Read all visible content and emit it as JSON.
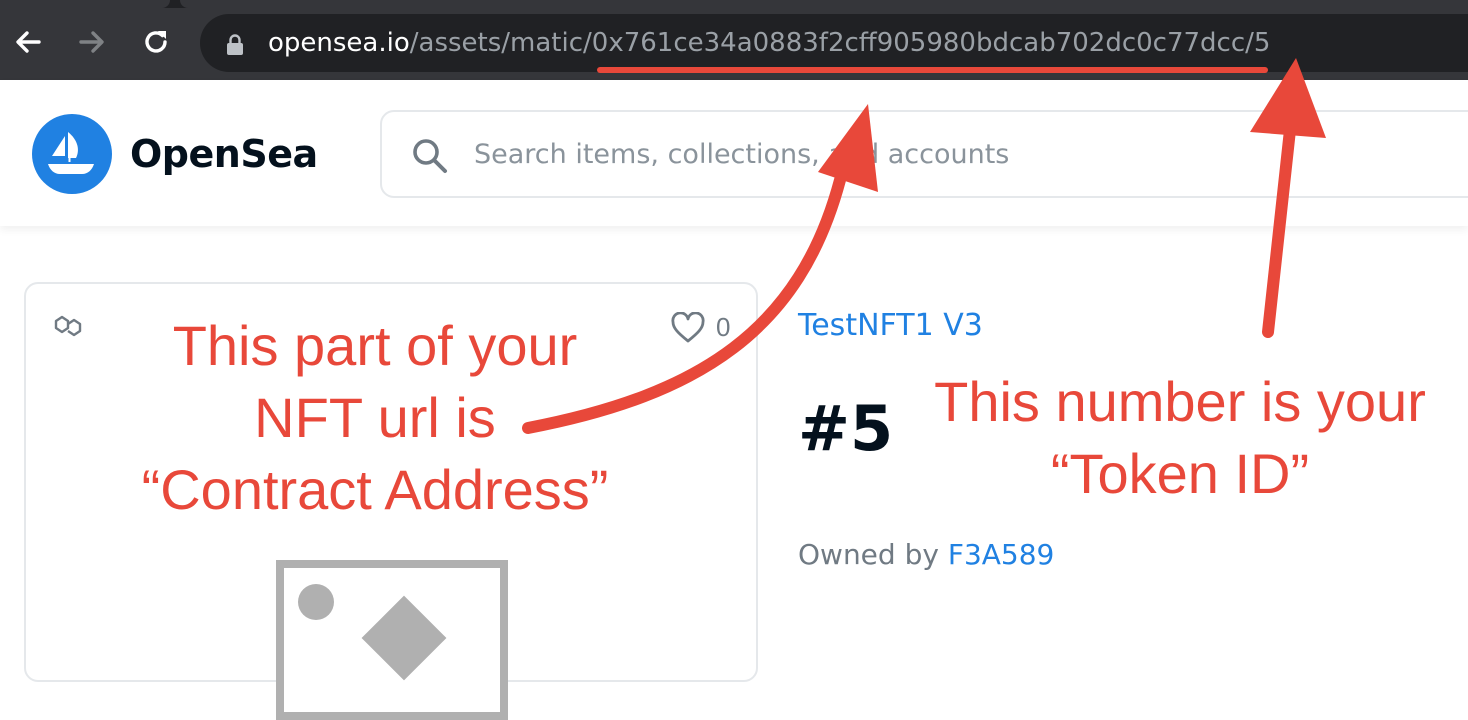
{
  "browser": {
    "url_host": "opensea.io",
    "url_path": "/assets/matic/0x761ce34a0883f2cff905980bdcab702dc0c77dcc/5"
  },
  "header": {
    "brand": "OpenSea",
    "search_placeholder": "Search items, collections, and accounts"
  },
  "card": {
    "favorite_count": "0"
  },
  "asset": {
    "collection": "TestNFT1 V3",
    "title": "#5",
    "owned_by_label": "Owned by ",
    "owner": "F3A589"
  },
  "annotations": {
    "contract": {
      "line1": "This part of your",
      "line2": "NFT url is",
      "line3": "“Contract Address”"
    },
    "token": {
      "line1": "This number is your",
      "line2": "“Token ID”"
    },
    "color": "#e8483a"
  },
  "colors": {
    "accent": "#2081e2",
    "browser_bar": "#35363a",
    "omnibox": "#202124"
  }
}
